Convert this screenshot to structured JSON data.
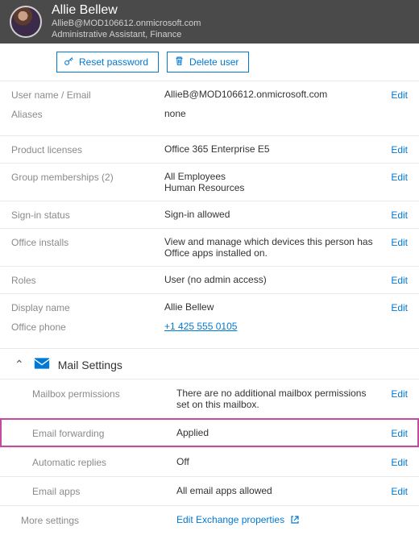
{
  "header": {
    "name": "Allie Bellew",
    "email": "AllieB@MOD106612.onmicrosoft.com",
    "role": "Administrative Assistant, Finance"
  },
  "buttons": {
    "reset_password": "Reset password",
    "delete_user": "Delete user"
  },
  "edit_label": "Edit",
  "rows": {
    "username_label": "User name / Email",
    "username_value": "AllieB@MOD106612.onmicrosoft.com",
    "aliases_label": "Aliases",
    "aliases_value": "none",
    "licenses_label": "Product licenses",
    "licenses_value": "Office 365 Enterprise E5",
    "groups_label": "Group memberships (2)",
    "groups_line1": "All Employees",
    "groups_line2": "Human Resources",
    "signin_label": "Sign-in status",
    "signin_value": "Sign-in allowed",
    "installs_label": "Office installs",
    "installs_value": "View and manage which devices this person has Office apps installed on.",
    "roles_label": "Roles",
    "roles_value": "User (no admin access)",
    "display_label": "Display name",
    "display_value": "Allie Bellew",
    "phone_label": "Office phone",
    "phone_value": "+1 425 555 0105"
  },
  "mail": {
    "title": "Mail Settings",
    "perm_label": "Mailbox permissions",
    "perm_value": "There are no additional mailbox permissions set on this mailbox.",
    "fwd_label": "Email forwarding",
    "fwd_value": "Applied",
    "auto_label": "Automatic replies",
    "auto_value": "Off",
    "apps_label": "Email apps",
    "apps_value": "All email apps allowed",
    "more_label": "More settings",
    "more_value": "Edit Exchange properties"
  }
}
